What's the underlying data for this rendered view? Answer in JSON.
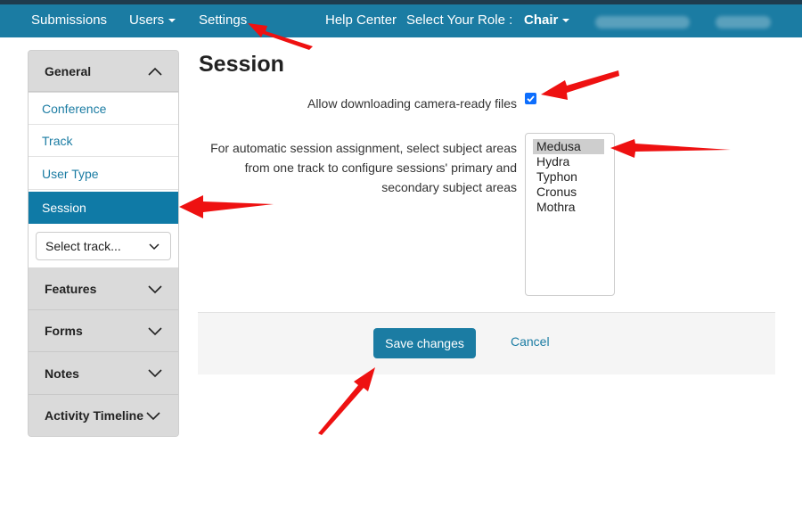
{
  "nav": {
    "submissions": "Submissions",
    "users": "Users",
    "settings": "Settings",
    "help": "Help Center",
    "role_label": "Select Your Role :",
    "role_value": "Chair"
  },
  "sidebar": {
    "general": "General",
    "items": [
      "Conference",
      "Track",
      "User Type",
      "Session"
    ],
    "select_placeholder": "Select track...",
    "sections": [
      "Features",
      "Forms",
      "Notes",
      "Activity Timeline"
    ]
  },
  "main": {
    "title": "Session",
    "checkbox_label": "Allow downloading camera-ready files",
    "subject_help": [
      "For automatic session assignment, select subject areas",
      "from one track to configure sessions' primary and",
      "secondary subject areas"
    ],
    "subject_options": [
      "Medusa",
      "Hydra",
      "Typhon",
      "Cronus",
      "Mothra"
    ],
    "save": "Save changes",
    "cancel": "Cancel"
  },
  "colors": {
    "navbar": "#1b7ca3",
    "active": "#0f7aa6",
    "link": "#1b7ca3",
    "annotation_arrow": "#ee1111"
  }
}
